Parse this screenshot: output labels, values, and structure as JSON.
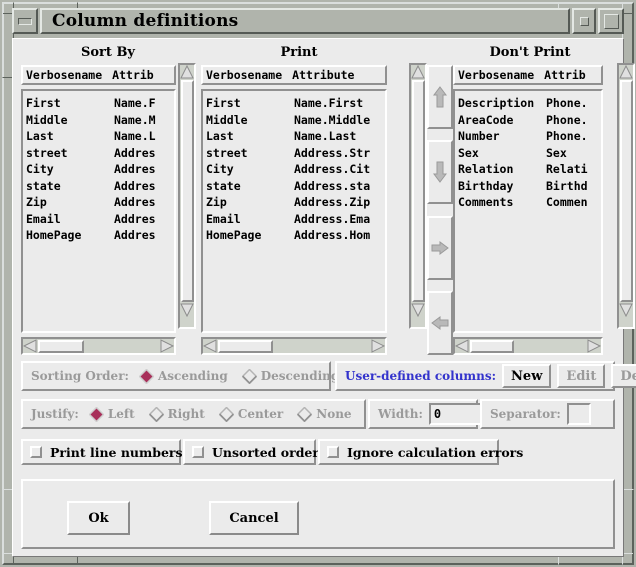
{
  "window": {
    "title": "Column definitions",
    "buttons": {
      "minimize": "minimize",
      "maximize_small": "maximize",
      "maximize_large": "restore"
    }
  },
  "columns": {
    "sort_by": {
      "title": "Sort By",
      "header": {
        "name": "Verbosename",
        "attribute": "Attrib"
      },
      "rows": [
        {
          "name": "First",
          "attribute": "Name.F"
        },
        {
          "name": "Middle",
          "attribute": "Name.M"
        },
        {
          "name": "Last",
          "attribute": "Name.L"
        },
        {
          "name": "street",
          "attribute": "Addres"
        },
        {
          "name": "City",
          "attribute": "Addres"
        },
        {
          "name": "state",
          "attribute": "Addres"
        },
        {
          "name": "Zip",
          "attribute": "Addres"
        },
        {
          "name": "Email",
          "attribute": "Addres"
        },
        {
          "name": "HomePage",
          "attribute": "Addres"
        }
      ]
    },
    "print": {
      "title": "Print",
      "header": {
        "name": "Verbosename",
        "attribute": "Attribute"
      },
      "rows": [
        {
          "name": "First",
          "attribute": "Name.First"
        },
        {
          "name": "Middle",
          "attribute": "Name.Middle"
        },
        {
          "name": "Last",
          "attribute": "Name.Last"
        },
        {
          "name": "street",
          "attribute": "Address.Str"
        },
        {
          "name": "City",
          "attribute": "Address.Cit"
        },
        {
          "name": "state",
          "attribute": "Address.sta"
        },
        {
          "name": "Zip",
          "attribute": "Address.Zip"
        },
        {
          "name": "Email",
          "attribute": "Address.Ema"
        },
        {
          "name": "HomePage",
          "attribute": "Address.Hom"
        }
      ]
    },
    "dont_print": {
      "title": "Don't Print",
      "header": {
        "name": "Verbosename",
        "attribute": "Attrib"
      },
      "rows": [
        {
          "name": "Description",
          "attribute": "Phone."
        },
        {
          "name": "AreaCode",
          "attribute": "Phone."
        },
        {
          "name": "Number",
          "attribute": "Phone."
        },
        {
          "name": "Sex",
          "attribute": "Sex"
        },
        {
          "name": "Relation",
          "attribute": "Relati"
        },
        {
          "name": "Birthday",
          "attribute": "Birthd"
        },
        {
          "name": "Comments",
          "attribute": "Commen"
        }
      ]
    }
  },
  "transfer_buttons": [
    {
      "name": "move-up-button",
      "icon": "arrow-up-icon"
    },
    {
      "name": "move-down-button",
      "icon": "arrow-down-icon"
    },
    {
      "name": "move-right-button",
      "icon": "arrow-right-icon"
    },
    {
      "name": "move-left-button",
      "icon": "arrow-left-icon"
    }
  ],
  "sorting_order": {
    "label": "Sorting Order:",
    "options": [
      {
        "label": "Ascending",
        "selected": true
      },
      {
        "label": "Descending",
        "selected": false
      }
    ],
    "enabled": false
  },
  "user_defined_columns": {
    "label": "User-defined columns:",
    "label_color": "#3333cc",
    "buttons": [
      {
        "label": "New",
        "enabled": true
      },
      {
        "label": "Edit",
        "enabled": false
      },
      {
        "label": "Delete",
        "enabled": false
      }
    ]
  },
  "justify": {
    "label": "Justify:",
    "options": [
      {
        "label": "Left",
        "selected": true
      },
      {
        "label": "Right",
        "selected": false
      },
      {
        "label": "Center",
        "selected": false
      },
      {
        "label": "None",
        "selected": false
      }
    ],
    "enabled": false
  },
  "width_field": {
    "label": "Width:",
    "value": "0"
  },
  "separator_field": {
    "label": "Separator:",
    "value": ""
  },
  "checkboxes": [
    {
      "label": "Print line numbers",
      "checked": false
    },
    {
      "label": "Unsorted order",
      "checked": false
    },
    {
      "label": "Ignore calculation errors",
      "checked": false
    }
  ],
  "actions": {
    "ok": "Ok",
    "cancel": "Cancel"
  },
  "colors": {
    "dialog_background": "#ebebeb",
    "frame": "#b0b4ac",
    "accent_blue": "#3333cc",
    "radio_selected": "#a8305a",
    "disabled_text": "#9a9a9a"
  }
}
